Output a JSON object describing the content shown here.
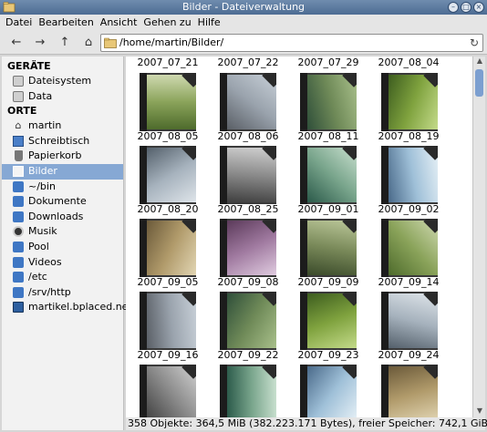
{
  "window": {
    "title": "Bilder - Dateiverwaltung"
  },
  "menu": [
    "Datei",
    "Bearbeiten",
    "Ansicht",
    "Gehen zu",
    "Hilfe"
  ],
  "toolbar": {
    "back_icon": "arrow-left-icon",
    "forward_icon": "arrow-right-icon",
    "up_icon": "arrow-up-icon",
    "home_icon": "home-icon",
    "location": "/home/martin/Bilder/",
    "reload_icon": "reload-icon"
  },
  "sidebar": {
    "devices_header": "GERÄTE",
    "devices": [
      {
        "label": "Dateisystem",
        "icon": "disk-icon"
      },
      {
        "label": "Data",
        "icon": "disk-icon"
      }
    ],
    "places_header": "ORTE",
    "places": [
      {
        "label": "martin",
        "icon": "home-icon"
      },
      {
        "label": "Schreibtisch",
        "icon": "desktop-icon"
      },
      {
        "label": "Papierkorb",
        "icon": "trash-icon"
      },
      {
        "label": "Bilder",
        "icon": "folder-icon",
        "selected": true
      },
      {
        "label": "~/bin",
        "icon": "folder-icon"
      },
      {
        "label": "Dokumente",
        "icon": "folder-icon"
      },
      {
        "label": "Downloads",
        "icon": "folder-icon"
      },
      {
        "label": "Musik",
        "icon": "music-icon"
      },
      {
        "label": "Pool",
        "icon": "folder-icon"
      },
      {
        "label": "Videos",
        "icon": "folder-icon"
      },
      {
        "label": "/etc",
        "icon": "folder-icon"
      },
      {
        "label": "/srv/http",
        "icon": "folder-icon"
      },
      {
        "label": "martikel.bplaced.net",
        "icon": "network-icon"
      }
    ]
  },
  "top_labels": [
    "2007_07_21",
    "2007_07_22",
    "2007_07_29",
    "2007_08_04"
  ],
  "folders": [
    "2007_08_05",
    "2007_08_06",
    "2007_08_11",
    "2007_08_19",
    "2007_08_20",
    "2007_08_25",
    "2007_09_01",
    "2007_09_02",
    "2007_09_05",
    "2007_09_08",
    "2007_09_09",
    "2007_09_14",
    "2007_09_16",
    "2007_09_22",
    "2007_09_23",
    "2007_09_24",
    "",
    "",
    "",
    ""
  ],
  "status": "358 Objekte: 364,5 MiB (382.223.171 Bytes), freier Speicher: 742,1 GiB",
  "colors": {
    "selection": "#86a8d4",
    "titlebar": "#5b7aa0",
    "folder": "#3f77c4"
  }
}
